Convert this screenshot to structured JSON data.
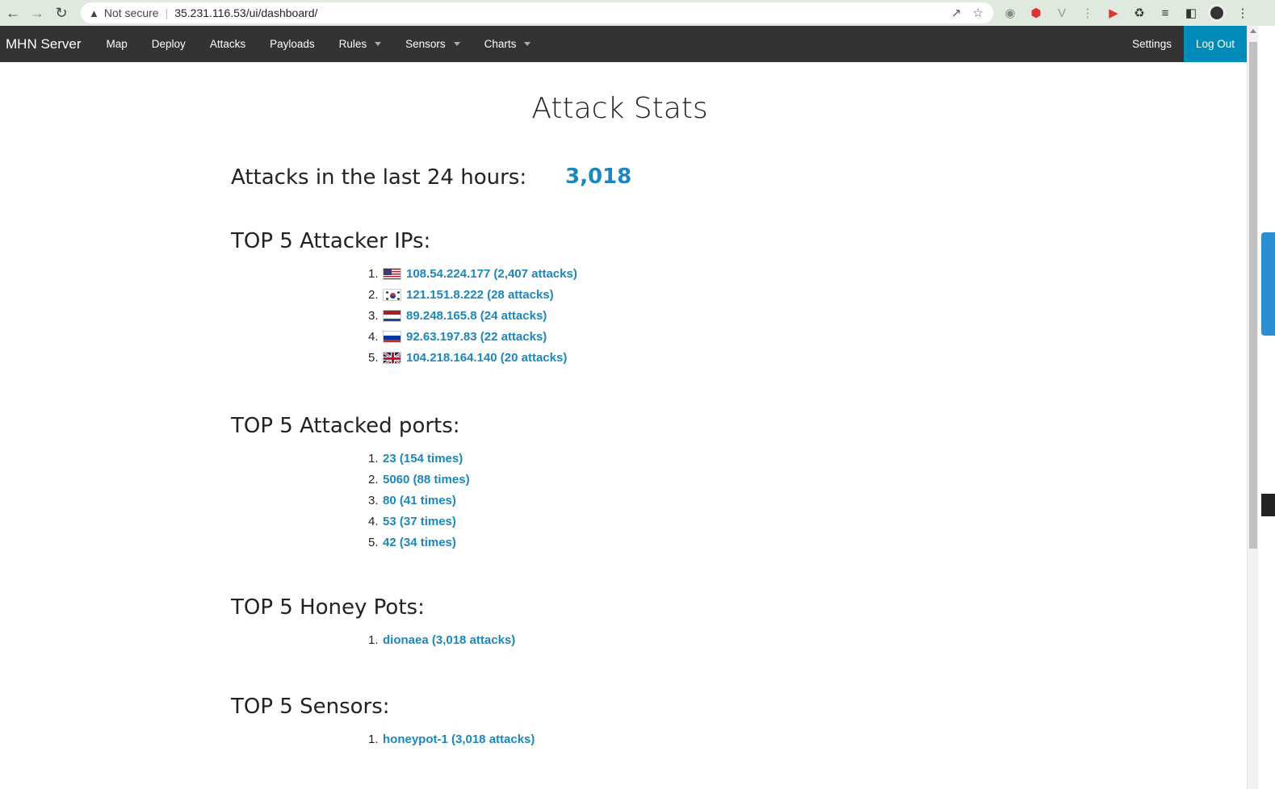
{
  "browser": {
    "not_secure": "Not secure",
    "url": "35.231.116.53/ui/dashboard/"
  },
  "navbar": {
    "brand": "MHN Server",
    "items": [
      "Map",
      "Deploy",
      "Attacks",
      "Payloads",
      "Rules",
      "Sensors",
      "Charts"
    ],
    "settings": "Settings",
    "logout": "Log Out"
  },
  "page": {
    "title": "Attack Stats",
    "attacks_label": "Attacks in the last 24 hours:",
    "attacks_value": "3,018"
  },
  "sections": {
    "ips_title": "TOP 5 Attacker IPs:",
    "ips": [
      {
        "num": "1.",
        "text": "108.54.224.177 (2,407 attacks)",
        "flag": "us-flag-icon"
      },
      {
        "num": "2.",
        "text": "121.151.8.222 (28 attacks)",
        "flag": "kr-flag-icon"
      },
      {
        "num": "3.",
        "text": "89.248.165.8 (24 attacks)",
        "flag": "nl-flag-icon"
      },
      {
        "num": "4.",
        "text": "92.63.197.83 (22 attacks)",
        "flag": "ru-flag-icon"
      },
      {
        "num": "5.",
        "text": "104.218.164.140 (20 attacks)",
        "flag": "gb-flag-icon"
      }
    ],
    "ports_title": "TOP 5 Attacked ports:",
    "ports": [
      {
        "num": "1.",
        "text": "23 (154 times)"
      },
      {
        "num": "2.",
        "text": "5060 (88 times)"
      },
      {
        "num": "3.",
        "text": "80 (41 times)"
      },
      {
        "num": "4.",
        "text": "53 (37 times)"
      },
      {
        "num": "5.",
        "text": "42 (34 times)"
      }
    ],
    "honeypots_title": "TOP 5 Honey Pots:",
    "honeypots": [
      {
        "num": "1.",
        "text": "dionaea (3,018 attacks)"
      }
    ],
    "sensors_title": "TOP 5 Sensors:",
    "sensors": [
      {
        "num": "1.",
        "text": "honeypot-1 (3,018 attacks)"
      }
    ]
  },
  "colors": {
    "link": "#1a87bd",
    "navbar": "#333333",
    "logout_bg": "#008cba"
  }
}
